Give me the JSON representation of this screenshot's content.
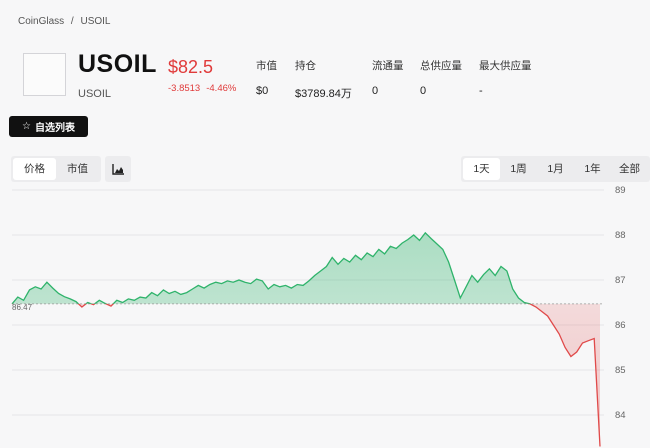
{
  "breadcrumb": {
    "root": "CoinGlass",
    "separator": "/",
    "current": "USOIL"
  },
  "header": {
    "symbol": "USOIL",
    "subtitle": "USOIL",
    "price": "$82.5",
    "change_abs": "-3.8513",
    "change_pct": "-4.46%",
    "price_color": "#e03a3a"
  },
  "stats": [
    {
      "label": "市值",
      "value": "$0"
    },
    {
      "label": "持仓",
      "value": "$3789.84万"
    },
    {
      "label": "流通量",
      "value": "0"
    },
    {
      "label": "总供应量",
      "value": "0"
    },
    {
      "label": "最大供应量",
      "value": "-"
    }
  ],
  "watchlist_button": {
    "icon": "star-icon",
    "label": "自选列表"
  },
  "view_toggle": {
    "options": [
      "价格",
      "市值"
    ],
    "active": "价格",
    "chart_type_icon": "bar-chart-icon"
  },
  "range_toggle": {
    "options": [
      "1天",
      "1周",
      "1月",
      "1年",
      "全部"
    ],
    "active": "1天"
  },
  "chart_data": {
    "type": "area",
    "baseline": 86.47,
    "baseline_label": "86.47",
    "ylim": [
      83.3,
      89.1
    ],
    "yticks": [
      89,
      88,
      87,
      86,
      85,
      84
    ],
    "up_color": "#2fb36b",
    "down_color": "#e04a4a",
    "values": [
      86.47,
      86.62,
      86.55,
      86.78,
      86.85,
      86.8,
      86.95,
      86.82,
      86.7,
      86.63,
      86.58,
      86.52,
      86.4,
      86.5,
      86.45,
      86.55,
      86.48,
      86.42,
      86.55,
      86.5,
      86.58,
      86.55,
      86.62,
      86.6,
      86.72,
      86.65,
      86.78,
      86.7,
      86.75,
      86.68,
      86.72,
      86.8,
      86.88,
      86.82,
      86.9,
      86.95,
      86.92,
      86.98,
      86.95,
      87.0,
      86.95,
      86.92,
      87.02,
      86.98,
      86.8,
      86.9,
      86.85,
      86.88,
      86.82,
      86.9,
      86.88,
      86.98,
      87.1,
      87.2,
      87.3,
      87.5,
      87.35,
      87.48,
      87.4,
      87.55,
      87.45,
      87.6,
      87.52,
      87.68,
      87.58,
      87.75,
      87.7,
      87.82,
      87.9,
      88.0,
      87.88,
      88.05,
      87.92,
      87.8,
      87.68,
      87.4,
      87.0,
      86.6,
      86.85,
      87.1,
      86.95,
      87.12,
      87.25,
      87.1,
      87.3,
      87.2,
      86.8,
      86.6,
      86.5,
      86.47,
      86.4,
      86.3,
      86.2,
      86.0,
      85.8,
      85.5,
      85.3,
      85.4,
      85.6,
      85.65,
      85.7,
      83.3
    ]
  }
}
